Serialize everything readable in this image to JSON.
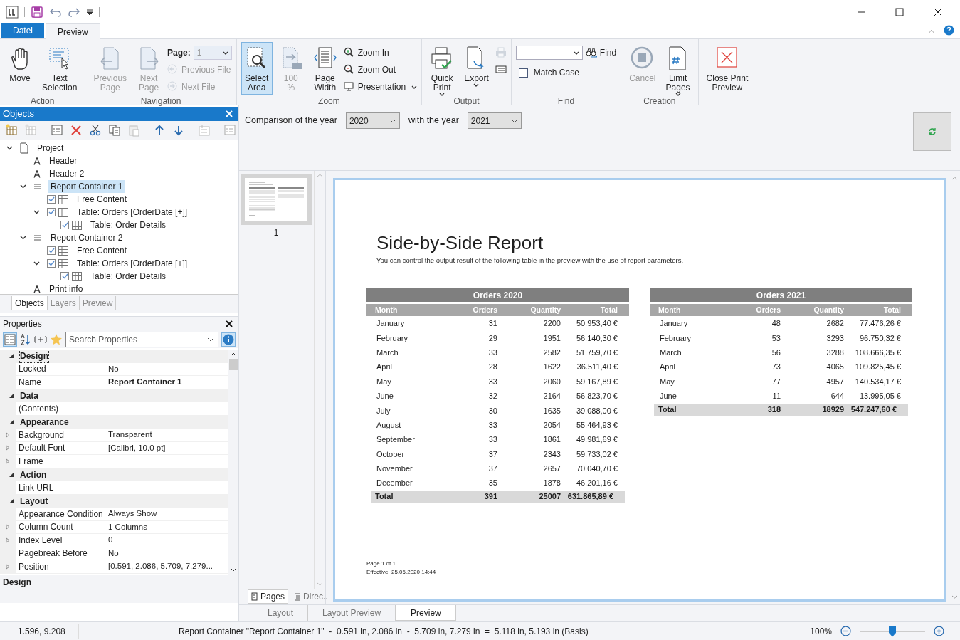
{
  "ribbon": {
    "tabs": [
      {
        "label": "Datei",
        "kind": "file",
        "selected": false
      },
      {
        "label": "Preview",
        "kind": "tab",
        "selected": true
      }
    ],
    "groups": [
      {
        "label": "Action",
        "items": [
          {
            "kind": "big",
            "label": "Move",
            "disabled": false,
            "selected": false
          },
          {
            "kind": "big",
            "label": "Text\nSelection",
            "disabled": false,
            "selected": false
          }
        ]
      },
      {
        "label": "Navigation",
        "items": [
          {
            "kind": "big",
            "label": "Previous\nPage",
            "disabled": true,
            "selected": false
          },
          {
            "kind": "big",
            "label": "Next\nPage",
            "disabled": true,
            "selected": false
          },
          {
            "kind": "field",
            "label": "Page:",
            "value": "1",
            "disabled": true
          },
          {
            "kind": "small",
            "label": "Previous File",
            "disabled": true
          },
          {
            "kind": "small",
            "label": "Next File",
            "disabled": true
          }
        ]
      },
      {
        "label": "Zoom",
        "items": [
          {
            "kind": "big",
            "label": "Select\nArea",
            "disabled": false,
            "selected": true
          },
          {
            "kind": "big",
            "label": "100\n%",
            "disabled": true,
            "selected": false
          },
          {
            "kind": "big",
            "label": "Page\nWidth",
            "disabled": false,
            "selected": false
          },
          {
            "kind": "small",
            "label": "Zoom In",
            "disabled": false
          },
          {
            "kind": "small",
            "label": "Zoom Out",
            "disabled": false
          },
          {
            "kind": "small",
            "label": "Presentation",
            "disabled": false,
            "dropdown": true
          }
        ]
      },
      {
        "label": "Output",
        "items": [
          {
            "kind": "big",
            "label": "Quick\nPrint",
            "disabled": false,
            "selected": false,
            "dropdown": true
          },
          {
            "kind": "big",
            "label": "Export",
            "disabled": false,
            "selected": false,
            "dropdown": true
          },
          {
            "kind": "small",
            "disabled": true
          },
          {
            "kind": "small",
            "disabled": false
          }
        ]
      },
      {
        "label": "Find",
        "items": [
          {
            "kind": "field",
            "disabled": false
          },
          {
            "kind": "checkbox",
            "label": "Match Case",
            "checked": false
          },
          {
            "kind": "break"
          },
          {
            "kind": "small",
            "label": "Find",
            "disabled": false
          }
        ]
      },
      {
        "label": "Creation",
        "items": [
          {
            "kind": "big",
            "label": "Cancel",
            "disabled": true,
            "selected": false
          },
          {
            "kind": "big",
            "label": "Limit\nPages",
            "disabled": false,
            "selected": false,
            "dropdown": true
          }
        ]
      },
      {
        "items": [
          {
            "kind": "big",
            "label": "Close Print\nPreview",
            "disabled": false,
            "selected": false
          }
        ]
      }
    ]
  },
  "objects": {
    "title": "Objects",
    "tree": [
      {
        "label": "Project",
        "kind": "page",
        "expanded": true,
        "selected": false,
        "children": [
          {
            "label": "Header",
            "kind": "text",
            "selected": false
          },
          {
            "label": "Header 2",
            "kind": "text",
            "selected": false
          },
          {
            "label": "Report Container 1",
            "kind": "container",
            "expanded": true,
            "selected": true,
            "children": [
              {
                "label": "Free Content",
                "kind": "table",
                "checked": true,
                "selected": false
              },
              {
                "label": "Table: Orders [OrderDate [+]]",
                "kind": "table",
                "checked": true,
                "expanded": true,
                "selected": false,
                "children": [
                  {
                    "label": "Table: Order Details",
                    "kind": "table",
                    "checked": true,
                    "selected": false
                  }
                ]
              }
            ]
          },
          {
            "label": "Report Container 2",
            "kind": "container",
            "expanded": true,
            "selected": false,
            "children": [
              {
                "label": "Free Content",
                "kind": "table",
                "checked": true,
                "selected": false
              },
              {
                "label": "Table: Orders [OrderDate [+]]",
                "kind": "table",
                "checked": true,
                "expanded": true,
                "selected": false,
                "children": [
                  {
                    "label": "Table: Order Details",
                    "kind": "table",
                    "checked": true,
                    "selected": false
                  }
                ]
              }
            ]
          },
          {
            "label": "Print info",
            "kind": "text",
            "selected": false
          }
        ]
      }
    ],
    "tabs": [
      {
        "label": "Objects",
        "selected": true
      },
      {
        "label": "Layers",
        "selected": false
      },
      {
        "label": "Preview",
        "selected": false
      }
    ]
  },
  "properties": {
    "title": "Properties",
    "search": {
      "placeholder": "Search Properties"
    },
    "categories": [
      {
        "name": "Design",
        "expanded": true,
        "focused": true,
        "props": [
          {
            "name": "Locked",
            "value": "No",
            "expandable": false
          },
          {
            "name": "Name",
            "value": "Report Container 1",
            "expandable": false,
            "bold": true
          }
        ]
      },
      {
        "name": "Data",
        "expanded": true,
        "focused": false,
        "props": [
          {
            "name": "(Contents)",
            "expandable": false
          }
        ]
      },
      {
        "name": "Appearance",
        "expanded": true,
        "focused": false,
        "props": [
          {
            "name": "Background",
            "value": "Transparent",
            "expandable": true
          },
          {
            "name": "Default Font",
            "value": "[Calibri, 10.0 pt]",
            "expandable": true
          },
          {
            "name": "Frame",
            "expandable": true
          }
        ]
      },
      {
        "name": "Action",
        "expanded": true,
        "focused": false,
        "props": [
          {
            "name": "Link URL",
            "expandable": false
          }
        ]
      },
      {
        "name": "Layout",
        "expanded": true,
        "focused": false,
        "props": [
          {
            "name": "Appearance Condition",
            "value": "Always Show",
            "expandable": false
          },
          {
            "name": "Column Count",
            "value": "1 Columns",
            "expandable": true
          },
          {
            "name": "Index Level",
            "value": "0",
            "expandable": true
          },
          {
            "name": "Pagebreak Before",
            "value": "No",
            "expandable": false
          },
          {
            "name": "Position",
            "value": "[0.591, 2.086, 5.709, 7.279...",
            "expandable": true
          }
        ]
      }
    ],
    "footer": "Design"
  },
  "parameters": [
    {
      "kind": "label",
      "text": "Comparison of the year"
    },
    {
      "kind": "select",
      "value": "2020"
    },
    {
      "kind": "label",
      "text": "with the year"
    },
    {
      "kind": "select",
      "value": "2021"
    }
  ],
  "thumbnails": {
    "pages": [
      {
        "label": "1",
        "selected": true
      }
    ],
    "tabs": [
      {
        "label": "Pages",
        "selected": true
      },
      {
        "label": "Direc..",
        "selected": false
      }
    ]
  },
  "report": {
    "title": "Side-by-Side Report",
    "subtitle": "You can control the output result of the following table in the preview with the use of report parameters.",
    "tables": [
      {
        "title": "Orders 2020",
        "columns": [
          "Month",
          "Orders",
          "Quantity",
          "Total"
        ],
        "rows": [
          [
            "January",
            "31",
            "2200",
            "50.953,40 €"
          ],
          [
            "February",
            "29",
            "1951",
            "56.140,30 €"
          ],
          [
            "March",
            "33",
            "2582",
            "51.759,70 €"
          ],
          [
            "April",
            "28",
            "1622",
            "36.511,40 €"
          ],
          [
            "May",
            "33",
            "2060",
            "59.167,89 €"
          ],
          [
            "June",
            "32",
            "2164",
            "56.823,70 €"
          ],
          [
            "July",
            "30",
            "1635",
            "39.088,00 €"
          ],
          [
            "August",
            "33",
            "2054",
            "55.464,93 €"
          ],
          [
            "September",
            "33",
            "1861",
            "49.981,69 €"
          ],
          [
            "October",
            "37",
            "2343",
            "59.733,02 €"
          ],
          [
            "November",
            "37",
            "2657",
            "70.040,70 €"
          ],
          [
            "December",
            "35",
            "1878",
            "46.201,16 €"
          ]
        ],
        "total": [
          "Total",
          "391",
          "25007",
          "631.865,89 €"
        ]
      },
      {
        "title": "Orders 2021",
        "columns": [
          "Month",
          "Orders",
          "Quantity",
          "Total"
        ],
        "rows": [
          [
            "January",
            "48",
            "2682",
            "77.476,26 €"
          ],
          [
            "February",
            "53",
            "3293",
            "96.750,32 €"
          ],
          [
            "March",
            "56",
            "3288",
            "108.666,35 €"
          ],
          [
            "April",
            "73",
            "4065",
            "109.825,45 €"
          ],
          [
            "May",
            "77",
            "4957",
            "140.534,17 €"
          ],
          [
            "June",
            "11",
            "644",
            "13.995,05 €"
          ]
        ],
        "total": [
          "Total",
          "318",
          "18929",
          "547.247,60 €"
        ]
      }
    ],
    "footer": [
      "Page 1 of 1",
      "Effective: 25.06.2020 14:44"
    ]
  },
  "view_tabs": [
    {
      "label": "Layout",
      "selected": false
    },
    {
      "label": "Layout Preview",
      "selected": false
    },
    {
      "label": "Preview",
      "selected": true
    }
  ],
  "status_bar": {
    "coordinates": "1.596, 9.208",
    "info": "Report Container \"Report Container 1\"  -  0.591 in, 2.086 in  -  5.709 in, 7.279 in  =  5.118 in, 5.193 in (Basis)",
    "zoom": "100%",
    "zoom_slider": {
      "level": 0.5
    }
  }
}
